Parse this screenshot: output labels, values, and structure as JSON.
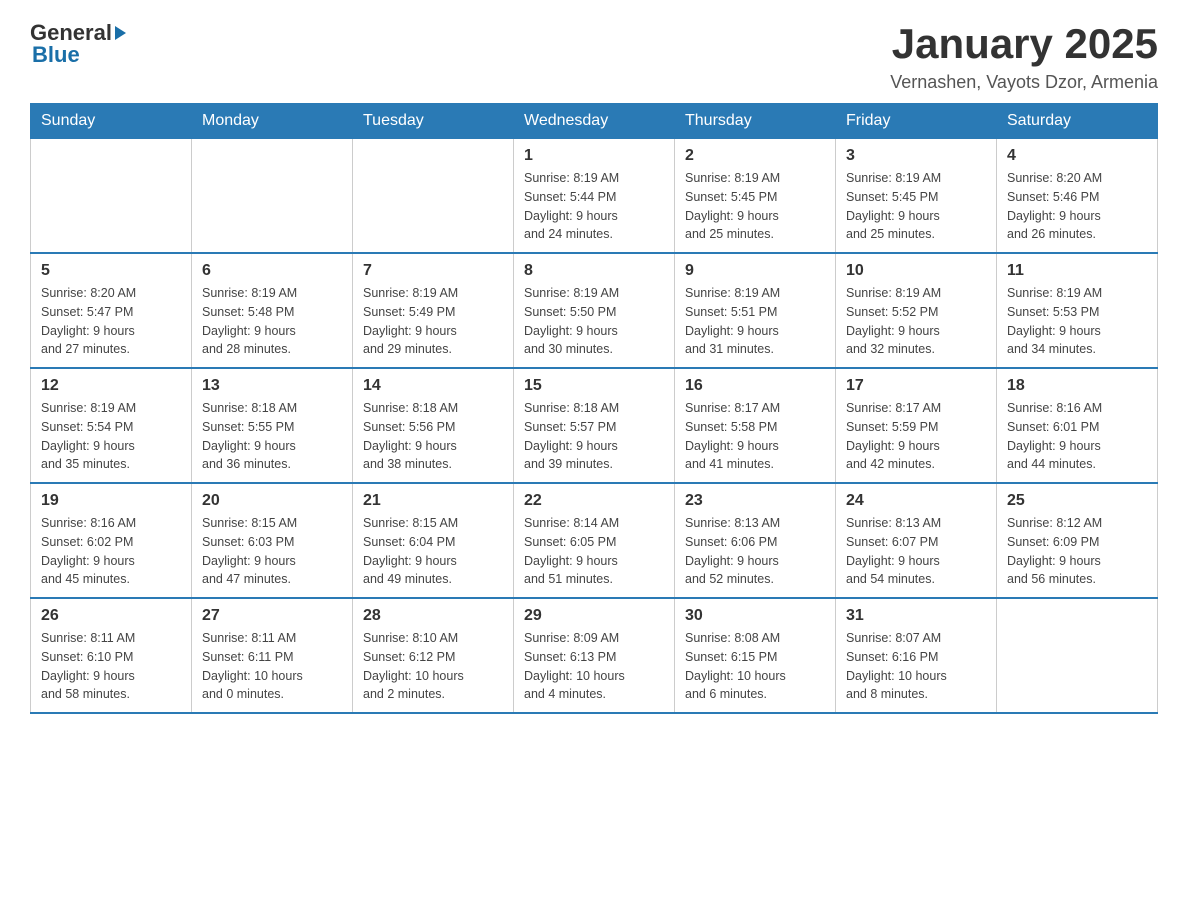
{
  "logo": {
    "text_general": "General",
    "text_blue": "Blue"
  },
  "title": "January 2025",
  "subtitle": "Vernashen, Vayots Dzor, Armenia",
  "days_of_week": [
    "Sunday",
    "Monday",
    "Tuesday",
    "Wednesday",
    "Thursday",
    "Friday",
    "Saturday"
  ],
  "weeks": [
    [
      {
        "day": "",
        "info": ""
      },
      {
        "day": "",
        "info": ""
      },
      {
        "day": "",
        "info": ""
      },
      {
        "day": "1",
        "info": "Sunrise: 8:19 AM\nSunset: 5:44 PM\nDaylight: 9 hours\nand 24 minutes."
      },
      {
        "day": "2",
        "info": "Sunrise: 8:19 AM\nSunset: 5:45 PM\nDaylight: 9 hours\nand 25 minutes."
      },
      {
        "day": "3",
        "info": "Sunrise: 8:19 AM\nSunset: 5:45 PM\nDaylight: 9 hours\nand 25 minutes."
      },
      {
        "day": "4",
        "info": "Sunrise: 8:20 AM\nSunset: 5:46 PM\nDaylight: 9 hours\nand 26 minutes."
      }
    ],
    [
      {
        "day": "5",
        "info": "Sunrise: 8:20 AM\nSunset: 5:47 PM\nDaylight: 9 hours\nand 27 minutes."
      },
      {
        "day": "6",
        "info": "Sunrise: 8:19 AM\nSunset: 5:48 PM\nDaylight: 9 hours\nand 28 minutes."
      },
      {
        "day": "7",
        "info": "Sunrise: 8:19 AM\nSunset: 5:49 PM\nDaylight: 9 hours\nand 29 minutes."
      },
      {
        "day": "8",
        "info": "Sunrise: 8:19 AM\nSunset: 5:50 PM\nDaylight: 9 hours\nand 30 minutes."
      },
      {
        "day": "9",
        "info": "Sunrise: 8:19 AM\nSunset: 5:51 PM\nDaylight: 9 hours\nand 31 minutes."
      },
      {
        "day": "10",
        "info": "Sunrise: 8:19 AM\nSunset: 5:52 PM\nDaylight: 9 hours\nand 32 minutes."
      },
      {
        "day": "11",
        "info": "Sunrise: 8:19 AM\nSunset: 5:53 PM\nDaylight: 9 hours\nand 34 minutes."
      }
    ],
    [
      {
        "day": "12",
        "info": "Sunrise: 8:19 AM\nSunset: 5:54 PM\nDaylight: 9 hours\nand 35 minutes."
      },
      {
        "day": "13",
        "info": "Sunrise: 8:18 AM\nSunset: 5:55 PM\nDaylight: 9 hours\nand 36 minutes."
      },
      {
        "day": "14",
        "info": "Sunrise: 8:18 AM\nSunset: 5:56 PM\nDaylight: 9 hours\nand 38 minutes."
      },
      {
        "day": "15",
        "info": "Sunrise: 8:18 AM\nSunset: 5:57 PM\nDaylight: 9 hours\nand 39 minutes."
      },
      {
        "day": "16",
        "info": "Sunrise: 8:17 AM\nSunset: 5:58 PM\nDaylight: 9 hours\nand 41 minutes."
      },
      {
        "day": "17",
        "info": "Sunrise: 8:17 AM\nSunset: 5:59 PM\nDaylight: 9 hours\nand 42 minutes."
      },
      {
        "day": "18",
        "info": "Sunrise: 8:16 AM\nSunset: 6:01 PM\nDaylight: 9 hours\nand 44 minutes."
      }
    ],
    [
      {
        "day": "19",
        "info": "Sunrise: 8:16 AM\nSunset: 6:02 PM\nDaylight: 9 hours\nand 45 minutes."
      },
      {
        "day": "20",
        "info": "Sunrise: 8:15 AM\nSunset: 6:03 PM\nDaylight: 9 hours\nand 47 minutes."
      },
      {
        "day": "21",
        "info": "Sunrise: 8:15 AM\nSunset: 6:04 PM\nDaylight: 9 hours\nand 49 minutes."
      },
      {
        "day": "22",
        "info": "Sunrise: 8:14 AM\nSunset: 6:05 PM\nDaylight: 9 hours\nand 51 minutes."
      },
      {
        "day": "23",
        "info": "Sunrise: 8:13 AM\nSunset: 6:06 PM\nDaylight: 9 hours\nand 52 minutes."
      },
      {
        "day": "24",
        "info": "Sunrise: 8:13 AM\nSunset: 6:07 PM\nDaylight: 9 hours\nand 54 minutes."
      },
      {
        "day": "25",
        "info": "Sunrise: 8:12 AM\nSunset: 6:09 PM\nDaylight: 9 hours\nand 56 minutes."
      }
    ],
    [
      {
        "day": "26",
        "info": "Sunrise: 8:11 AM\nSunset: 6:10 PM\nDaylight: 9 hours\nand 58 minutes."
      },
      {
        "day": "27",
        "info": "Sunrise: 8:11 AM\nSunset: 6:11 PM\nDaylight: 10 hours\nand 0 minutes."
      },
      {
        "day": "28",
        "info": "Sunrise: 8:10 AM\nSunset: 6:12 PM\nDaylight: 10 hours\nand 2 minutes."
      },
      {
        "day": "29",
        "info": "Sunrise: 8:09 AM\nSunset: 6:13 PM\nDaylight: 10 hours\nand 4 minutes."
      },
      {
        "day": "30",
        "info": "Sunrise: 8:08 AM\nSunset: 6:15 PM\nDaylight: 10 hours\nand 6 minutes."
      },
      {
        "day": "31",
        "info": "Sunrise: 8:07 AM\nSunset: 6:16 PM\nDaylight: 10 hours\nand 8 minutes."
      },
      {
        "day": "",
        "info": ""
      }
    ]
  ]
}
